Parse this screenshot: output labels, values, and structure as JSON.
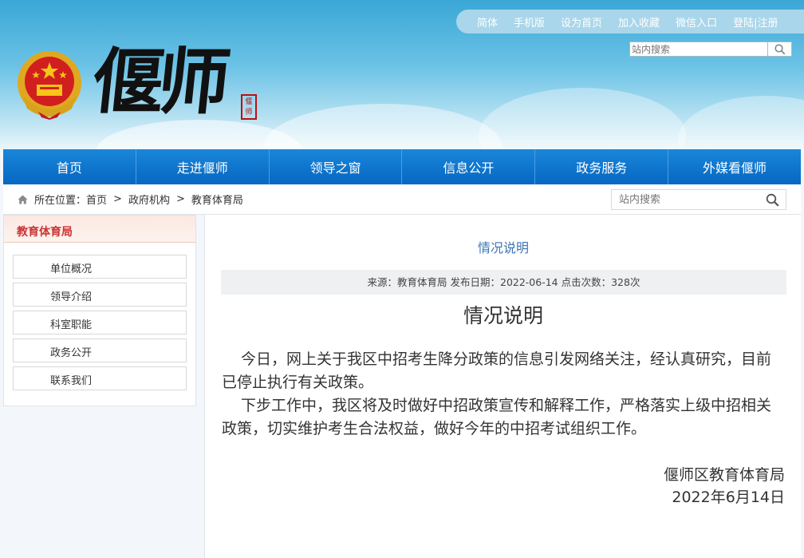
{
  "header": {
    "top_links": [
      "简体",
      "手机版",
      "设为首页",
      "加入收藏",
      "微信入口",
      "登陆|注册"
    ],
    "search_placeholder": "站内搜索",
    "logo_text": "偃师",
    "seal_text": "偃师"
  },
  "nav": {
    "items": [
      "首页",
      "走进偃师",
      "领导之窗",
      "信息公开",
      "政务服务",
      "外媒看偃师"
    ]
  },
  "breadcrumb": {
    "label": "所在位置：",
    "items": [
      "首页",
      "政府机构",
      "教育体育局"
    ],
    "search_placeholder": "站内搜索"
  },
  "sidebar": {
    "title": "教育体育局",
    "items": [
      "单位概况",
      "领导介绍",
      "科室职能",
      "政务公开",
      "联系我们"
    ]
  },
  "article": {
    "section_title": "情况说明",
    "meta": "来源：教育体育局 发布日期：2022-06-14 点击次数：328次",
    "heading": "情况说明",
    "paragraphs": [
      "今日，网上关于我区中招考生降分政策的信息引发网络关注，经认真研究，目前已停止执行有关政策。",
      "下步工作中，我区将及时做好中招政策宣传和解释工作，严格落实上级中招相关政策，切实维护考生合法权益，做好今年的中招考试组织工作。"
    ],
    "signature_org": "偃师区教育体育局",
    "signature_date": "2022年6月14日"
  },
  "colors": {
    "nav_blue": "#0a6fc8",
    "sidebar_title_red": "#cc3333",
    "section_title_blue": "#3e76b3"
  },
  "icons": [
    "national-emblem-icon",
    "search-icon",
    "home-icon"
  ]
}
